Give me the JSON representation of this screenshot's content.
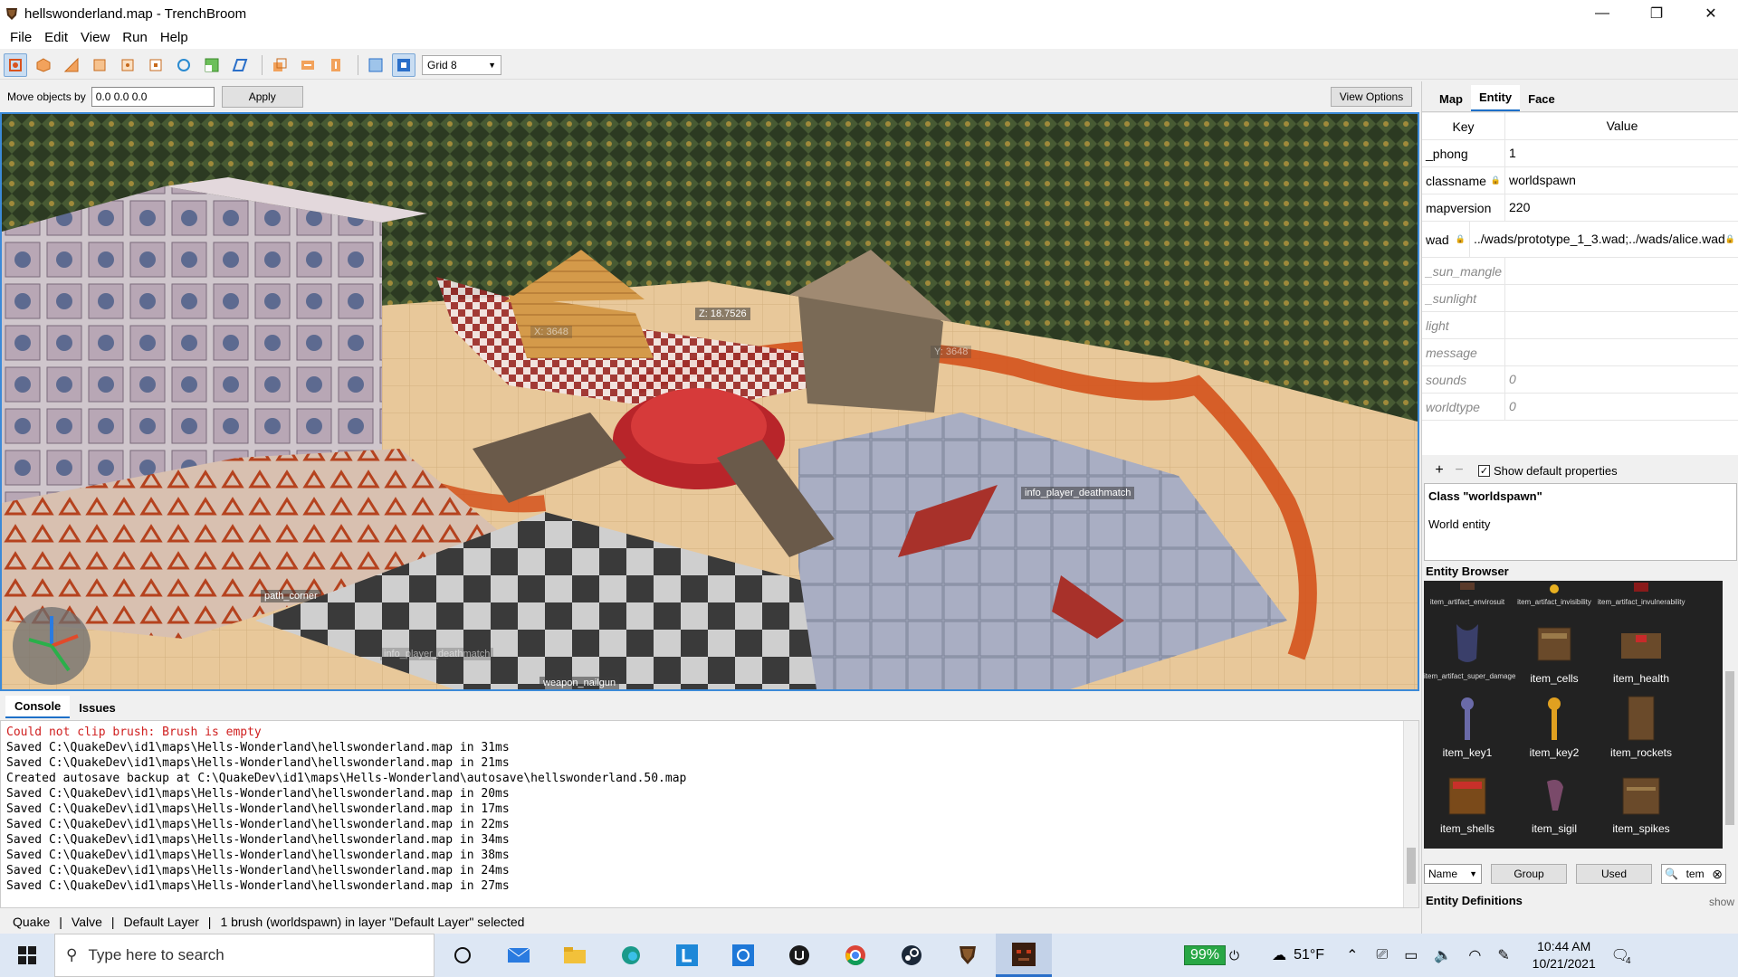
{
  "window": {
    "title": "hellswonderland.map - TrenchBroom",
    "minimize": "—",
    "maximize": "❐",
    "close": "✕"
  },
  "menu": [
    "File",
    "Edit",
    "View",
    "Run",
    "Help"
  ],
  "toolbar": {
    "grid_label": "Grid 8"
  },
  "movebar": {
    "label": "Move objects by",
    "value": "0.0 0.0 0.0",
    "apply_label": "Apply",
    "view_options_label": "View Options"
  },
  "viewport": {
    "labels": {
      "z_readout": "Z: 18.7526",
      "x_readout": "X: 3648",
      "y_readout": "Y: 3648",
      "deathmatch": "info_player_deathmatch",
      "path_corner": "path_corner",
      "deathmatch_faint": "info_player_deathmatch",
      "weapon_nailgun": "weapon_nailgun"
    }
  },
  "console": {
    "tabs": [
      "Console",
      "Issues"
    ],
    "error_line": "Could not clip brush: Brush is empty",
    "lines": [
      "Saved C:\\QuakeDev\\id1\\maps\\Hells-Wonderland\\hellswonderland.map in 31ms",
      "Saved C:\\QuakeDev\\id1\\maps\\Hells-Wonderland\\hellswonderland.map in 21ms",
      "Created autosave backup at C:\\QuakeDev\\id1\\maps\\Hells-Wonderland\\autosave\\hellswonderland.50.map",
      "Saved C:\\QuakeDev\\id1\\maps\\Hells-Wonderland\\hellswonderland.map in 20ms",
      "Saved C:\\QuakeDev\\id1\\maps\\Hells-Wonderland\\hellswonderland.map in 17ms",
      "Saved C:\\QuakeDev\\id1\\maps\\Hells-Wonderland\\hellswonderland.map in 22ms",
      "Saved C:\\QuakeDev\\id1\\maps\\Hells-Wonderland\\hellswonderland.map in 34ms",
      "Saved C:\\QuakeDev\\id1\\maps\\Hells-Wonderland\\hellswonderland.map in 38ms",
      "Saved C:\\QuakeDev\\id1\\maps\\Hells-Wonderland\\hellswonderland.map in 24ms",
      "Saved C:\\QuakeDev\\id1\\maps\\Hells-Wonderland\\hellswonderland.map in 27ms"
    ]
  },
  "status": {
    "game": "Quake",
    "format": "Valve",
    "layer": "Default Layer",
    "selection": "1 brush (worldspawn) in layer \"Default Layer\" selected",
    "sep": "|"
  },
  "inspector": {
    "tabs": [
      "Map",
      "Entity",
      "Face"
    ],
    "key_header": "Key",
    "value_header": "Value",
    "rows": [
      {
        "key": "_phong",
        "value": "1"
      },
      {
        "key": "classname",
        "value": "worldspawn"
      },
      {
        "key": "mapversion",
        "value": "220"
      },
      {
        "key": "wad",
        "value": "../wads/prototype_1_3.wad;../wads/alice.wad"
      },
      {
        "key": "_sun_mangle",
        "value": ""
      },
      {
        "key": "_sunlight",
        "value": ""
      },
      {
        "key": "light",
        "value": ""
      },
      {
        "key": "message",
        "value": ""
      },
      {
        "key": "sounds",
        "value": "0"
      },
      {
        "key": "worldtype",
        "value": "0"
      }
    ],
    "add_btn": "+",
    "remove_btn": "−",
    "show_default_label": "Show default properties",
    "class_title": "Class \"worldspawn\"",
    "class_desc": "World entity"
  },
  "entity_browser": {
    "title": "Entity Browser",
    "items": [
      {
        "label": "item_artifact_envirosuit"
      },
      {
        "label": "item_artifact_invisibility"
      },
      {
        "label": "item_artifact_invulnerability"
      },
      {
        "label": "item_artifact_super_damage"
      },
      {
        "label": "item_cells"
      },
      {
        "label": "item_health"
      },
      {
        "label": "item_key1"
      },
      {
        "label": "item_key2"
      },
      {
        "label": "item_rockets"
      },
      {
        "label": "item_shells"
      },
      {
        "label": "item_sigil"
      },
      {
        "label": "item_spikes"
      }
    ],
    "sort_label": "Name",
    "group_label": "Group",
    "used_label": "Used",
    "search_value": "tem",
    "defs_title": "Entity Definitions",
    "defs_show": "show"
  },
  "taskbar": {
    "search_placeholder": "Type here to search",
    "battery": "99%",
    "temperature": "51°F",
    "time": "10:44 AM",
    "date": "10/21/2021",
    "notifications": "4"
  }
}
